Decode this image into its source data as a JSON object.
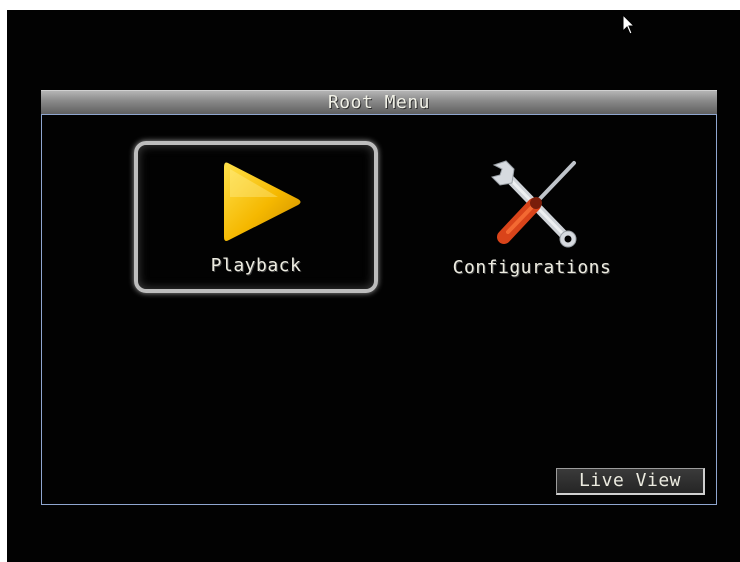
{
  "window": {
    "title": "Root Menu"
  },
  "menu": {
    "items": [
      {
        "label": "Playback",
        "icon": "play-icon",
        "selected": true
      },
      {
        "label": "Configurations",
        "icon": "wrench-screwdriver-icon",
        "selected": false
      }
    ]
  },
  "footer": {
    "live_view_label": "Live View"
  },
  "colors": {
    "background": "#020202",
    "panel_border": "#8fa6cf",
    "label_text": "#ecebe0",
    "play_icon": "#f5b800"
  }
}
